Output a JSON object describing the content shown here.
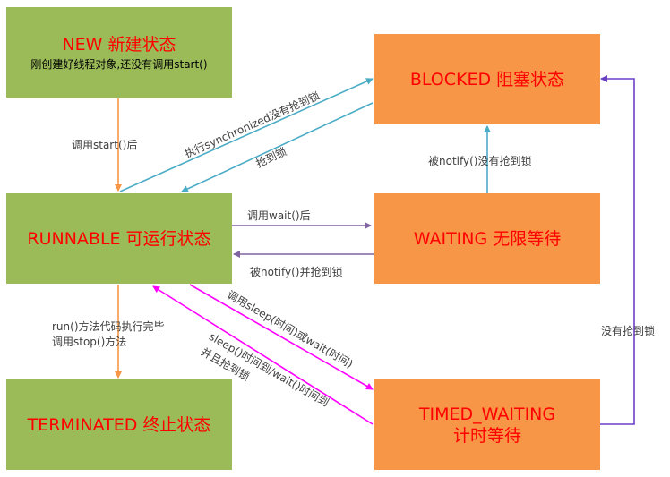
{
  "states": {
    "new": {
      "title": "NEW 新建状态",
      "subtitle": "刚创建好线程对象,还没有调用start()"
    },
    "runnable": {
      "title": "RUNNABLE 可运行状态"
    },
    "blocked": {
      "title": "BLOCKED 阻塞状态"
    },
    "waiting": {
      "title": "WAITING 无限等待"
    },
    "terminated": {
      "title": "TERMINATED 终止状态"
    },
    "timed_waiting": {
      "title_line1": "TIMED_WAITING",
      "title_line2": "计时等待"
    }
  },
  "transitions": {
    "new_to_runnable": "调用start()后",
    "runnable_to_blocked": "执行synchronized没有抢到锁",
    "blocked_to_runnable": "抢到锁",
    "waiting_to_blocked": "被notify()没有抢到锁",
    "runnable_to_waiting": "调用wait()后",
    "waiting_to_runnable": "被notify()并抢到锁",
    "runnable_to_terminated_line1": "run()方法代码执行完毕",
    "runnable_to_terminated_line2": "调用stop()方法",
    "runnable_to_timed_waiting": "调用sleep(时间)或wait(时间)",
    "timed_waiting_to_runnable_line1": "sleep()时间到/wait()时间到",
    "timed_waiting_to_runnable_line2": "并且抢到锁",
    "timed_waiting_to_blocked": "没有抢到锁"
  },
  "colors": {
    "green_state": "#9bbb59",
    "orange_state": "#f79646",
    "state_title": "#ff0000",
    "arrow_orange": "#f79646",
    "arrow_teal": "#4bacc6",
    "arrow_purple": "#8064a2",
    "arrow_magenta": "#ff00ff",
    "arrow_violet": "#6a3fc8"
  }
}
